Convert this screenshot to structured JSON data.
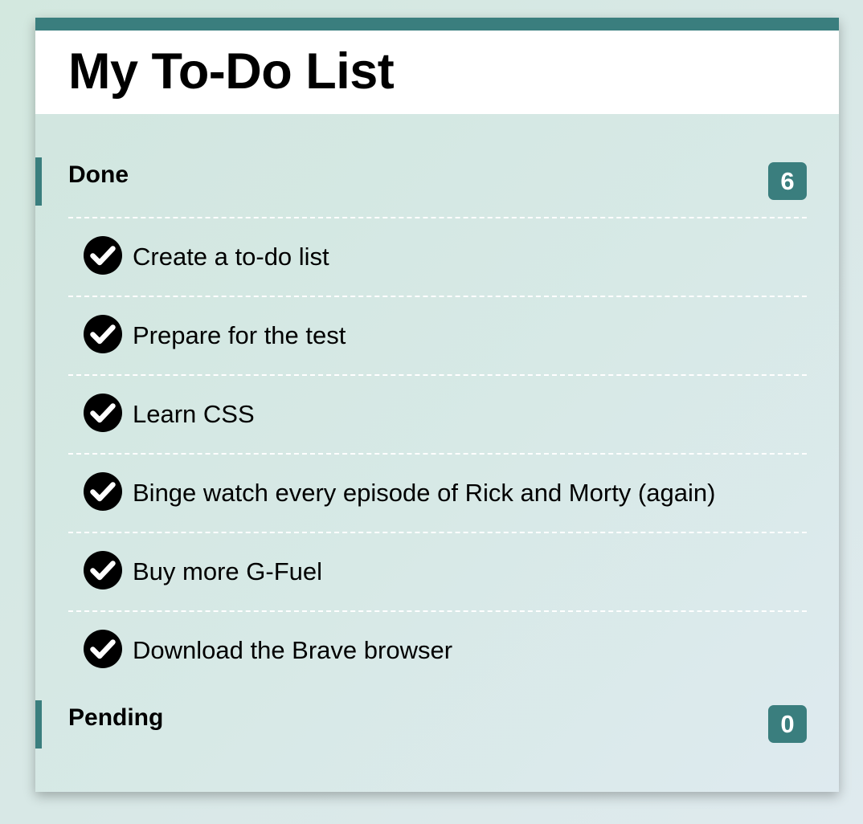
{
  "title": "My To-Do List",
  "sections": {
    "done": {
      "label": "Done",
      "count": "6",
      "items": [
        "Create a to-do list",
        "Prepare for the test",
        "Learn CSS",
        "Binge watch every episode of Rick and Morty (again)",
        "Buy more G-Fuel",
        "Download the Brave browser"
      ]
    },
    "pending": {
      "label": "Pending",
      "count": "0",
      "items": []
    }
  },
  "colors": {
    "accent": "#3a7e7e",
    "background": "#d5e8e2",
    "header": "#ffffff"
  },
  "icons": {
    "item_status": "check-circle-icon"
  }
}
